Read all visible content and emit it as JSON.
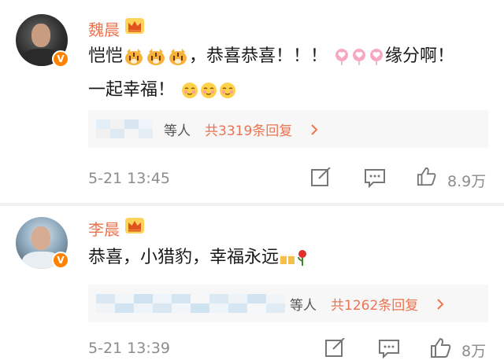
{
  "comments": [
    {
      "username": "魏晨",
      "text_a": "恺恺",
      "text_b": "，恭喜恭喜！！！",
      "text_c": "缘分啊！",
      "text_d": "一起幸福！",
      "reply_who": "等人",
      "reply_count": "共3319条回复",
      "time": "5-21 13:45",
      "likes": "8.9万"
    },
    {
      "username": "李晨",
      "text_a": "恭喜，小猎豹，幸福永远",
      "reply_who": "等人",
      "reply_count": "共1262条回复",
      "time": "5-21 13:39",
      "likes": "8万"
    }
  ],
  "icons": {
    "verified": "verified-v-badge",
    "crown": "vip-crown-icon",
    "chevron": "chevron-right-icon",
    "share": "share-edit-icon",
    "comment": "comment-icon",
    "like": "thumb-up-icon"
  },
  "colors": {
    "username": "#eb7350",
    "reply_count": "#eb7350",
    "meta": "#8c8c8c",
    "badge": "#ff8200"
  }
}
